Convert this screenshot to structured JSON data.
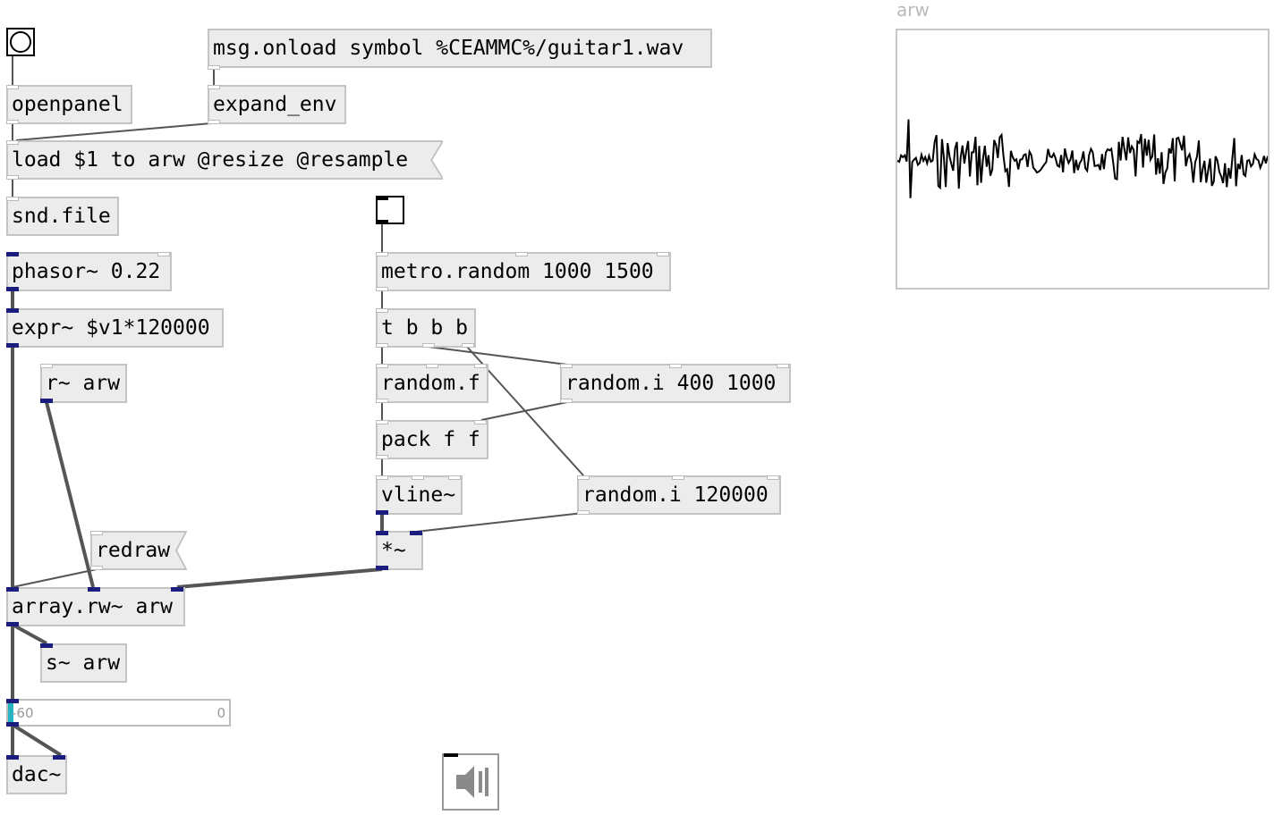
{
  "patch": {
    "objects": {
      "openpanel": "openpanel",
      "expand_env": "expand_env",
      "snd_file": "snd.file",
      "phasor": "phasor~ 0.22",
      "expr": "expr~ $v1*120000",
      "r_arw": "r~ arw",
      "metro": "metro.random 1000 1500",
      "trigger": "t b b b",
      "random_f": "random.f",
      "random_i_1": "random.i 400 1000",
      "pack": "pack f f",
      "vline": "vline~",
      "random_i_2": "random.i 120000",
      "mul": "*~",
      "array_rw": "array.rw~ arw",
      "s_arw": "s~ arw",
      "dac": "dac~"
    },
    "messages": {
      "onload": "msg.onload symbol %CEAMMC%/guitar1.wav",
      "load": "load $1 to arw @resize @resample",
      "redraw": "redraw"
    },
    "array": {
      "name": "arw"
    },
    "vu_meter": {
      "min_label": "-60",
      "max_label": "0",
      "level_fraction": 0.02
    },
    "icons": {
      "bang": "bang-icon",
      "toggle": "toggle-icon",
      "speaker": "speaker-icon"
    },
    "colors": {
      "signal_port": "#1d1d80",
      "object_fill": "#ececec",
      "object_border": "#c4c4c4",
      "vu_level": "#27b3c2"
    }
  }
}
